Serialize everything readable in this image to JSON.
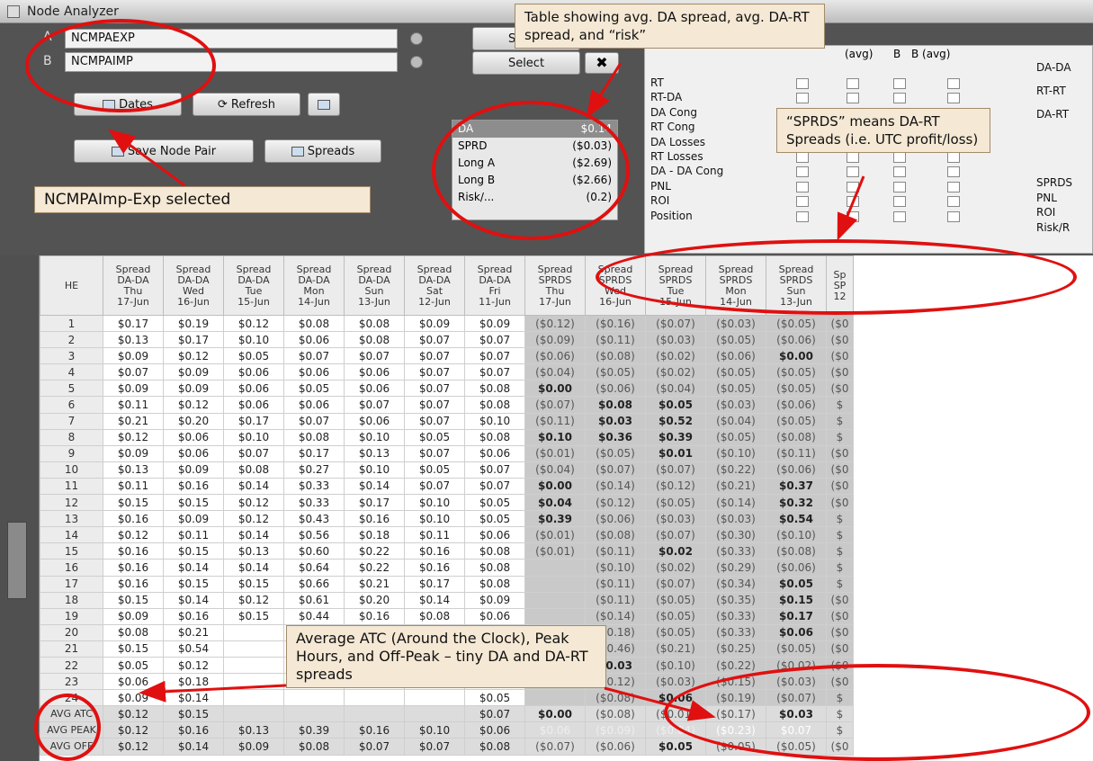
{
  "window": {
    "title": "Node Analyzer"
  },
  "nodes": {
    "a_label": "A",
    "a_value": "NCMPAEXP",
    "b_label": "B",
    "b_value": "NCMPAIMP",
    "select_a": "Select",
    "select_b": "Select"
  },
  "buttons": {
    "dates": "Dates",
    "refresh": "Refresh",
    "save_pair": "Save Node Pair",
    "spreads": "Spreads"
  },
  "summary": [
    {
      "label": "DA",
      "value": "$0.14"
    },
    {
      "label": "SPRD",
      "value": "($0.03)"
    },
    {
      "label": "Long A",
      "value": "($2.69)"
    },
    {
      "label": "Long B",
      "value": "($2.66)"
    },
    {
      "label": "Risk/...",
      "value": "(0.2)"
    }
  ],
  "selector": {
    "headers": [
      "(avg)",
      "B",
      "B (avg)"
    ],
    "rows": [
      "RT",
      "RT-DA",
      "DA Cong",
      "RT Cong",
      "DA Losses",
      "RT Losses",
      "DA - DA Cong",
      "PNL",
      "ROI",
      "Position"
    ],
    "right_list": [
      "DA-DA",
      "RT-RT",
      "DA-RT",
      "SPRDS",
      "PNL",
      "ROI",
      "Risk/R"
    ]
  },
  "grid": {
    "he_header": "HE",
    "columns": [
      {
        "l1": "Spread",
        "l2": "DA-DA",
        "l3": "Thu",
        "l4": "17-Jun"
      },
      {
        "l1": "Spread",
        "l2": "DA-DA",
        "l3": "Wed",
        "l4": "16-Jun"
      },
      {
        "l1": "Spread",
        "l2": "DA-DA",
        "l3": "Tue",
        "l4": "15-Jun"
      },
      {
        "l1": "Spread",
        "l2": "DA-DA",
        "l3": "Mon",
        "l4": "14-Jun"
      },
      {
        "l1": "Spread",
        "l2": "DA-DA",
        "l3": "Sun",
        "l4": "13-Jun"
      },
      {
        "l1": "Spread",
        "l2": "DA-DA",
        "l3": "Sat",
        "l4": "12-Jun"
      },
      {
        "l1": "Spread",
        "l2": "DA-DA",
        "l3": "Fri",
        "l4": "11-Jun"
      },
      {
        "l1": "Spread",
        "l2": "SPRDS",
        "l3": "Thu",
        "l4": "17-Jun"
      },
      {
        "l1": "Spread",
        "l2": "SPRDS",
        "l3": "Wed",
        "l4": "16-Jun"
      },
      {
        "l1": "Spread",
        "l2": "SPRDS",
        "l3": "Tue",
        "l4": "15-Jun"
      },
      {
        "l1": "Spread",
        "l2": "SPRDS",
        "l3": "Mon",
        "l4": "14-Jun"
      },
      {
        "l1": "Spread",
        "l2": "SPRDS",
        "l3": "Sun",
        "l4": "13-Jun"
      },
      {
        "l1": "Sp",
        "l2": "SP",
        "l3": "",
        "l4": "12"
      }
    ],
    "rows": [
      [
        "1",
        "$0.17",
        "$0.19",
        "$0.12",
        "$0.08",
        "$0.08",
        "$0.09",
        "$0.09",
        "($0.12)",
        "($0.16)",
        "($0.07)",
        "($0.03)",
        "($0.05)",
        "($0"
      ],
      [
        "2",
        "$0.13",
        "$0.17",
        "$0.10",
        "$0.06",
        "$0.08",
        "$0.07",
        "$0.07",
        "($0.09)",
        "($0.11)",
        "($0.03)",
        "($0.05)",
        "($0.06)",
        "($0"
      ],
      [
        "3",
        "$0.09",
        "$0.12",
        "$0.05",
        "$0.07",
        "$0.07",
        "$0.07",
        "$0.07",
        "($0.06)",
        "($0.08)",
        "($0.02)",
        "($0.06)",
        "$0.00",
        "($0"
      ],
      [
        "4",
        "$0.07",
        "$0.09",
        "$0.06",
        "$0.06",
        "$0.06",
        "$0.07",
        "$0.07",
        "($0.04)",
        "($0.05)",
        "($0.02)",
        "($0.05)",
        "($0.05)",
        "($0"
      ],
      [
        "5",
        "$0.09",
        "$0.09",
        "$0.06",
        "$0.05",
        "$0.06",
        "$0.07",
        "$0.08",
        "$0.00",
        "($0.06)",
        "($0.04)",
        "($0.05)",
        "($0.05)",
        "($0"
      ],
      [
        "6",
        "$0.11",
        "$0.12",
        "$0.06",
        "$0.06",
        "$0.07",
        "$0.07",
        "$0.08",
        "($0.07)",
        "$0.08",
        "$0.05",
        "($0.03)",
        "($0.06)",
        "$"
      ],
      [
        "7",
        "$0.21",
        "$0.20",
        "$0.17",
        "$0.07",
        "$0.06",
        "$0.07",
        "$0.10",
        "($0.11)",
        "$0.03",
        "$0.52",
        "($0.04)",
        "($0.05)",
        "$"
      ],
      [
        "8",
        "$0.12",
        "$0.06",
        "$0.10",
        "$0.08",
        "$0.10",
        "$0.05",
        "$0.08",
        "$0.10",
        "$0.36",
        "$0.39",
        "($0.05)",
        "($0.08)",
        "$"
      ],
      [
        "9",
        "$0.09",
        "$0.06",
        "$0.07",
        "$0.17",
        "$0.13",
        "$0.07",
        "$0.06",
        "($0.01)",
        "($0.05)",
        "$0.01",
        "($0.10)",
        "($0.11)",
        "($0"
      ],
      [
        "10",
        "$0.13",
        "$0.09",
        "$0.08",
        "$0.27",
        "$0.10",
        "$0.05",
        "$0.07",
        "($0.04)",
        "($0.07)",
        "($0.07)",
        "($0.22)",
        "($0.06)",
        "($0"
      ],
      [
        "11",
        "$0.11",
        "$0.16",
        "$0.14",
        "$0.33",
        "$0.14",
        "$0.07",
        "$0.07",
        "$0.00",
        "($0.14)",
        "($0.12)",
        "($0.21)",
        "$0.37",
        "($0"
      ],
      [
        "12",
        "$0.15",
        "$0.15",
        "$0.12",
        "$0.33",
        "$0.17",
        "$0.10",
        "$0.05",
        "$0.04",
        "($0.12)",
        "($0.05)",
        "($0.14)",
        "$0.32",
        "($0"
      ],
      [
        "13",
        "$0.16",
        "$0.09",
        "$0.12",
        "$0.43",
        "$0.16",
        "$0.10",
        "$0.05",
        "$0.39",
        "($0.06)",
        "($0.03)",
        "($0.03)",
        "$0.54",
        "$"
      ],
      [
        "14",
        "$0.12",
        "$0.11",
        "$0.14",
        "$0.56",
        "$0.18",
        "$0.11",
        "$0.06",
        "($0.01)",
        "($0.08)",
        "($0.07)",
        "($0.30)",
        "($0.10)",
        "$"
      ],
      [
        "15",
        "$0.16",
        "$0.15",
        "$0.13",
        "$0.60",
        "$0.22",
        "$0.16",
        "$0.08",
        "($0.01)",
        "($0.11)",
        "$0.02",
        "($0.33)",
        "($0.08)",
        "$"
      ],
      [
        "16",
        "$0.16",
        "$0.14",
        "$0.14",
        "$0.64",
        "$0.22",
        "$0.16",
        "$0.08",
        "",
        "($0.10)",
        "($0.02)",
        "($0.29)",
        "($0.06)",
        "$"
      ],
      [
        "17",
        "$0.16",
        "$0.15",
        "$0.15",
        "$0.66",
        "$0.21",
        "$0.17",
        "$0.08",
        "",
        "($0.11)",
        "($0.07)",
        "($0.34)",
        "$0.05",
        "$"
      ],
      [
        "18",
        "$0.15",
        "$0.14",
        "$0.12",
        "$0.61",
        "$0.20",
        "$0.14",
        "$0.09",
        "",
        "($0.11)",
        "($0.05)",
        "($0.35)",
        "$0.15",
        "($0"
      ],
      [
        "19",
        "$0.09",
        "$0.16",
        "$0.15",
        "$0.44",
        "$0.16",
        "$0.08",
        "$0.06",
        "",
        "($0.14)",
        "($0.05)",
        "($0.33)",
        "$0.17",
        "($0"
      ],
      [
        "20",
        "$0.08",
        "$0.21",
        "",
        "",
        "",
        "",
        "$0.04",
        "",
        "($0.18)",
        "($0.05)",
        "($0.33)",
        "$0.06",
        "($0"
      ],
      [
        "21",
        "$0.15",
        "$0.54",
        "",
        "",
        "",
        "",
        "$0.04",
        "",
        "($0.46)",
        "($0.21)",
        "($0.25)",
        "($0.05)",
        "($0"
      ],
      [
        "22",
        "$0.05",
        "$0.12",
        "",
        "",
        "",
        "",
        "$0.04",
        "",
        "$0.03",
        "($0.10)",
        "($0.22)",
        "($0.02)",
        "($0"
      ],
      [
        "23",
        "$0.06",
        "$0.18",
        "",
        "",
        "",
        "",
        "$0.03",
        "",
        "($0.12)",
        "($0.03)",
        "($0.15)",
        "($0.03)",
        "($0"
      ],
      [
        "24",
        "$0.09",
        "$0.14",
        "",
        "",
        "",
        "",
        "$0.05",
        "",
        "($0.08)",
        "$0.06",
        "($0.19)",
        "($0.07)",
        "$"
      ]
    ],
    "avg_rows": [
      [
        "AVG ATC",
        "$0.12",
        "$0.15",
        "",
        "",
        "",
        "",
        "$0.07",
        "$0.00",
        "($0.08)",
        "($0.01)",
        "($0.17)",
        "$0.03",
        "$"
      ],
      [
        "AVG PEAK",
        "$0.12",
        "$0.16",
        "$0.13",
        "$0.39",
        "$0.16",
        "$0.10",
        "$0.06",
        "$0.06",
        "($0.09)",
        "($0.04)",
        "($0.23)",
        "$0.07",
        "$"
      ],
      [
        "AVG OFF",
        "$0.12",
        "$0.14",
        "$0.09",
        "$0.08",
        "$0.07",
        "$0.07",
        "$0.08",
        "($0.07)",
        "($0.06)",
        "$0.05",
        "($0.05)",
        "($0.05)",
        "($0"
      ]
    ]
  },
  "annotations": {
    "table_note": "Table showing avg. DA spread, avg. DA-RT spread, and “risk”",
    "sprds_note": "“SPRDS” means DA-RT Spreads (i.e. UTC profit/loss)",
    "selected_note": "NCMPAImp-Exp selected",
    "avg_note": "Average ATC (Around the Clock), Peak Hours, and Off-Peak – tiny DA and DA-RT spreads"
  },
  "colors": {
    "annotation_red": "#e01010",
    "note_bg": "#f5e8d4"
  }
}
